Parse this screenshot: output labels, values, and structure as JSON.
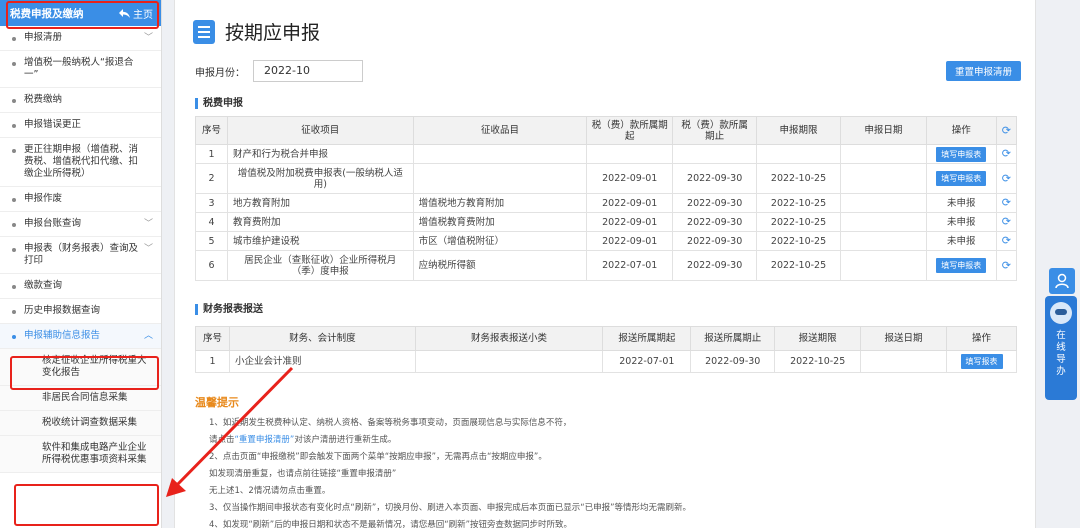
{
  "sidebar": {
    "header_title": "税费申报及缴纳",
    "home_label": "主页",
    "items": [
      {
        "label": "申报清册",
        "chev": true
      },
      {
        "label": "增值税一般纳税人“报退合一”",
        "chev": false
      },
      {
        "label": "税费缴纳",
        "chev": false
      },
      {
        "label": "申报错误更正",
        "chev": false
      },
      {
        "label": "更正往期申报（增值税、消费税、增值税代扣代缴、扣缴企业所得税）",
        "chev": false
      },
      {
        "label": "申报作废",
        "chev": false
      },
      {
        "label": "申报台账查询",
        "chev": true
      },
      {
        "label": "申报表（财务报表）查询及打印",
        "chev": true
      },
      {
        "label": "缴款查询",
        "chev": false
      },
      {
        "label": "历史申报数据查询",
        "chev": false
      },
      {
        "label": "申报辅助信息报告",
        "chev": true
      }
    ],
    "sub_items": [
      "核定征收企业所得税重大变化报告",
      "非居民合同信息采集",
      "税收统计调查数据采集",
      "软件和集成电路产业企业所得税优惠事项资料采集"
    ]
  },
  "main": {
    "title": "按期应申报",
    "month_label": "申报月份：",
    "month_value": "2022-10",
    "reset_button": "重置申报清册",
    "tax_section_title": "税费申报",
    "tax_headers": [
      "序号",
      "征收项目",
      "征收品目",
      "税（费）款所属期起",
      "税（费）款所属期止",
      "申报期限",
      "申报日期",
      "操作"
    ],
    "tax_rows": [
      {
        "no": "1",
        "item": "财产和行为税合并申报",
        "sub": "",
        "start": "",
        "end": "",
        "deadline": "",
        "date": "",
        "op": "填写申报表",
        "op_btn": true
      },
      {
        "no": "2",
        "item": "增值税及附加税费申报表(一般纳税人适用)",
        "sub": "",
        "start": "2022-09-01",
        "end": "2022-09-30",
        "deadline": "2022-10-25",
        "date": "",
        "op": "填写申报表",
        "op_btn": true
      },
      {
        "no": "3",
        "item": "地方教育附加",
        "sub": "增值税地方教育附加",
        "start": "2022-09-01",
        "end": "2022-09-30",
        "deadline": "2022-10-25",
        "date": "",
        "op": "未申报",
        "op_btn": false
      },
      {
        "no": "4",
        "item": "教育费附加",
        "sub": "增值税教育费附加",
        "start": "2022-09-01",
        "end": "2022-09-30",
        "deadline": "2022-10-25",
        "date": "",
        "op": "未申报",
        "op_btn": false
      },
      {
        "no": "5",
        "item": "城市维护建设税",
        "sub": "市区（增值税附征）",
        "start": "2022-09-01",
        "end": "2022-09-30",
        "deadline": "2022-10-25",
        "date": "",
        "op": "未申报",
        "op_btn": false
      },
      {
        "no": "6",
        "item": "居民企业（查账征收）企业所得税月（季）度申报",
        "sub": "应纳税所得额",
        "start": "2022-07-01",
        "end": "2022-09-30",
        "deadline": "2022-10-25",
        "date": "",
        "op": "填写申报表",
        "op_btn": true
      }
    ],
    "fin_section_title": "财务报表报送",
    "fin_headers": [
      "序号",
      "财务、会计制度",
      "财务报表报送小类",
      "报送所属期起",
      "报送所属期止",
      "报送期限",
      "报送日期",
      "操作"
    ],
    "fin_rows": [
      {
        "no": "1",
        "system": "小企业会计准则",
        "sub": "",
        "start": "2022-07-01",
        "end": "2022-09-30",
        "deadline": "2022-10-25",
        "date": "",
        "op": "填写报表"
      }
    ],
    "tips_title": "温馨提示",
    "tips": {
      "l1": "1、如近期发生税费种认定、纳税人资格、备案等税务事项变动，页面展现信息与实际信息不符，",
      "l2a": "请点击",
      "l2link": "“重置申报清册”",
      "l2b": "对该户清册进行重新生成。",
      "l3": "2、点击页面“申报缴税”即会触发下面两个菜单“按期应申报”，无需再点击“按期应申报”。",
      "l4": "如发现清册重复，也请点前往链接“重置申报清册”",
      "l5": "无上述1、2情况请勿点击重置。",
      "l6": "3、仅当操作期间申报状态有变化时点“刷新”，切换月份、刷进入本页面、申报完成后本页面已显示“已申报”等情形均无需刷新。",
      "l7": "4、如发现“刷新”后的申报日期和状态不是最新情况，请您悬回“刷新”按钮旁查数据同步时所致。"
    }
  },
  "float_widget": {
    "label": "在线导办"
  },
  "colors": {
    "accent": "#3a8ee6",
    "highlight": "#e8221b",
    "warning": "#e8891b"
  }
}
